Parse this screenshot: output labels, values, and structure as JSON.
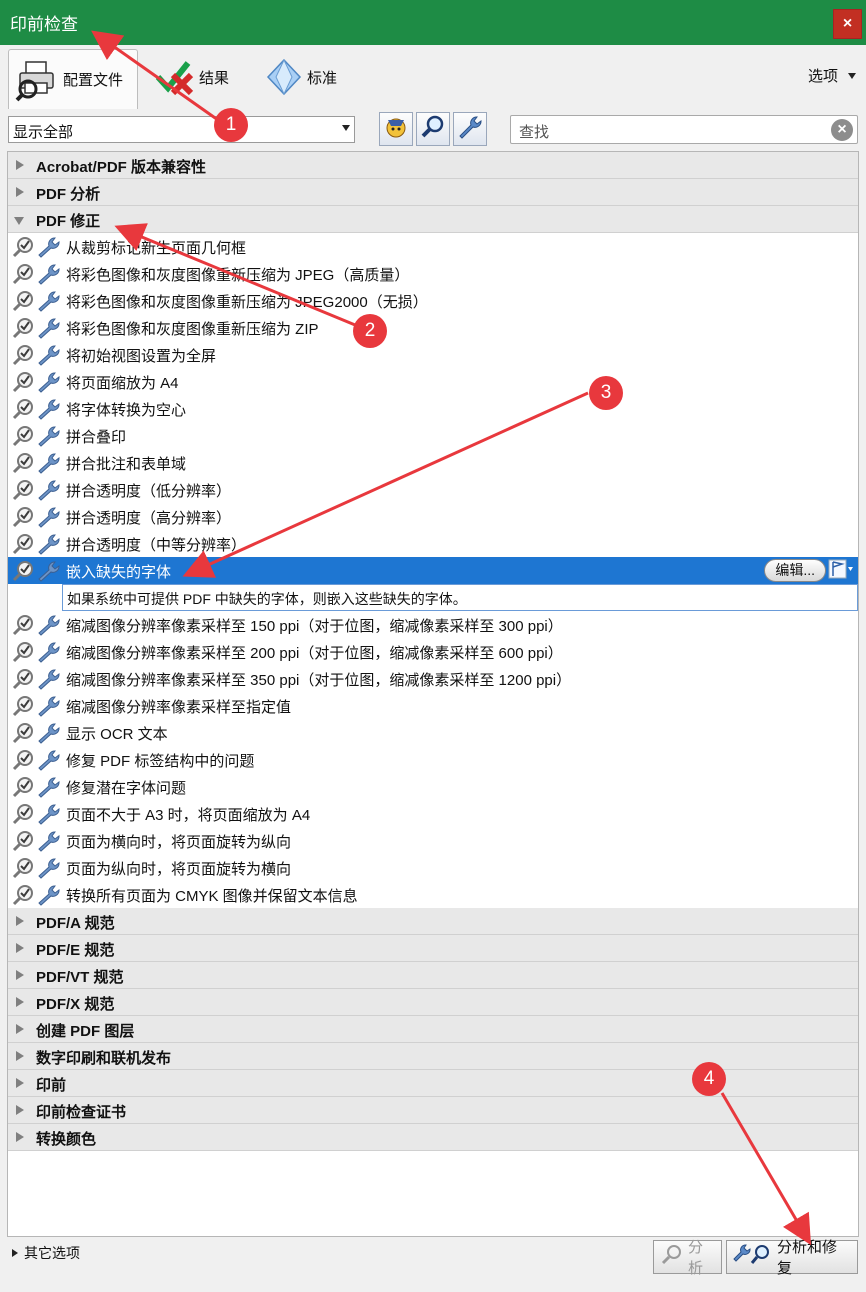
{
  "window": {
    "title": "印前检查",
    "close_glyph": "×"
  },
  "tabs": [
    {
      "label": "配置文件",
      "icon": "printer-icon"
    },
    {
      "label": "结果",
      "icon": "check-x-icon"
    },
    {
      "label": "标准",
      "icon": "diamond-icon"
    }
  ],
  "options_label": "选项",
  "filter": {
    "selected": "显示全部"
  },
  "search": {
    "placeholder": "查找"
  },
  "categories_top": [
    {
      "label": "Acrobat/PDF 版本兼容性",
      "expanded": false
    },
    {
      "label": "PDF 分析",
      "expanded": false
    },
    {
      "label": "PDF 修正",
      "expanded": true
    }
  ],
  "fixups": [
    "从裁剪标记新生页面几何框",
    "将彩色图像和灰度图像重新压缩为 JPEG（高质量）",
    "将彩色图像和灰度图像重新压缩为 JPEG2000（无损）",
    "将彩色图像和灰度图像重新压缩为 ZIP",
    "将初始视图设置为全屏",
    "将页面缩放为 A4",
    "将字体转换为空心",
    "拼合叠印",
    "拼合批注和表单域",
    "拼合透明度（低分辨率）",
    "拼合透明度（高分辨率）",
    "拼合透明度（中等分辨率）"
  ],
  "selected_fixup": {
    "label": "嵌入缺失的字体",
    "edit_label": "编辑...",
    "description": "如果系统中可提供 PDF 中缺失的字体，则嵌入这些缺失的字体。"
  },
  "fixups_after": [
    "缩减图像分辨率像素采样至 150 ppi（对于位图，缩减像素采样至 300 ppi）",
    "缩减图像分辨率像素采样至 200 ppi（对于位图，缩减像素采样至 600 ppi）",
    "缩减图像分辨率像素采样至 350 ppi（对于位图，缩减像素采样至 1200 ppi）",
    "缩减图像分辨率像素采样至指定值",
    "显示 OCR 文本",
    "修复 PDF 标签结构中的问题",
    "修复潜在字体问题",
    "页面不大于 A3 时，将页面缩放为 A4",
    "页面为横向时，将页面旋转为纵向",
    "页面为纵向时，将页面旋转为横向",
    "转换所有页面为 CMYK 图像并保留文本信息"
  ],
  "categories_bottom": [
    "PDF/A 规范",
    "PDF/E 规范",
    "PDF/VT 规范",
    "PDF/X 规范",
    "创建 PDF 图层",
    "数字印刷和联机发布",
    "印前",
    "印前检查证书",
    "转换颜色"
  ],
  "footer": {
    "more_options": "其它选项",
    "analyze": "分析",
    "analyze_fix": "分析和修复"
  },
  "annotations": [
    "1",
    "2",
    "3",
    "4"
  ],
  "colors": {
    "title_bar": "#1e8c45",
    "selection": "#1e76d2",
    "annotation": "#e8383d"
  }
}
